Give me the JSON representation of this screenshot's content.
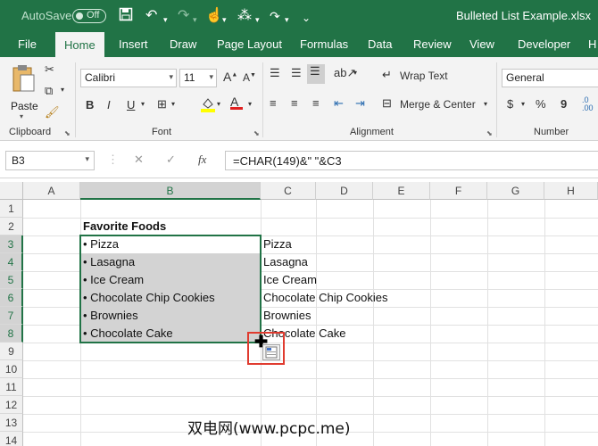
{
  "titlebar": {
    "autosave_label": "AutoSave",
    "autosave_state": "Off",
    "filename": "Bulleted List Example.xlsx"
  },
  "tabs": [
    "File",
    "Home",
    "Insert",
    "Draw",
    "Page Layout",
    "Formulas",
    "Data",
    "Review",
    "View",
    "Developer",
    "H"
  ],
  "ribbon": {
    "clipboard": {
      "label": "Clipboard",
      "paste": "Paste"
    },
    "font": {
      "label": "Font",
      "name": "Calibri",
      "size": "11",
      "bold": "B",
      "italic": "I",
      "underline": "U"
    },
    "alignment": {
      "label": "Alignment",
      "wrap_text": "Wrap Text",
      "merge_center": "Merge & Center"
    },
    "number": {
      "label": "Number",
      "format": "General",
      "currency": "$",
      "percent": "%",
      "comma": "9"
    }
  },
  "formula_bar": {
    "name_box": "B3",
    "fx": "fx",
    "formula": "=CHAR(149)&\" \"&C3"
  },
  "grid": {
    "columns": [
      "A",
      "B",
      "C",
      "D",
      "E",
      "F",
      "G",
      "H"
    ],
    "rows": [
      "1",
      "2",
      "3",
      "4",
      "5",
      "6",
      "7",
      "8",
      "9",
      "10",
      "11",
      "12",
      "13",
      "14"
    ],
    "heading": "Favorite Foods",
    "column_b": [
      "• Pizza",
      "• Lasagna",
      "• Ice Cream",
      "• Chocolate Chip Cookies",
      "• Brownies",
      "• Chocolate Cake"
    ],
    "column_c": [
      "Pizza",
      "Lasagna",
      "Ice Cream",
      "Chocolate Chip Cookies",
      "Brownies",
      "Chocolate Cake"
    ]
  },
  "watermark": "双电网(www.pcpc.me)",
  "colors": {
    "accent": "#217346",
    "highlight": "#e03b2f"
  }
}
